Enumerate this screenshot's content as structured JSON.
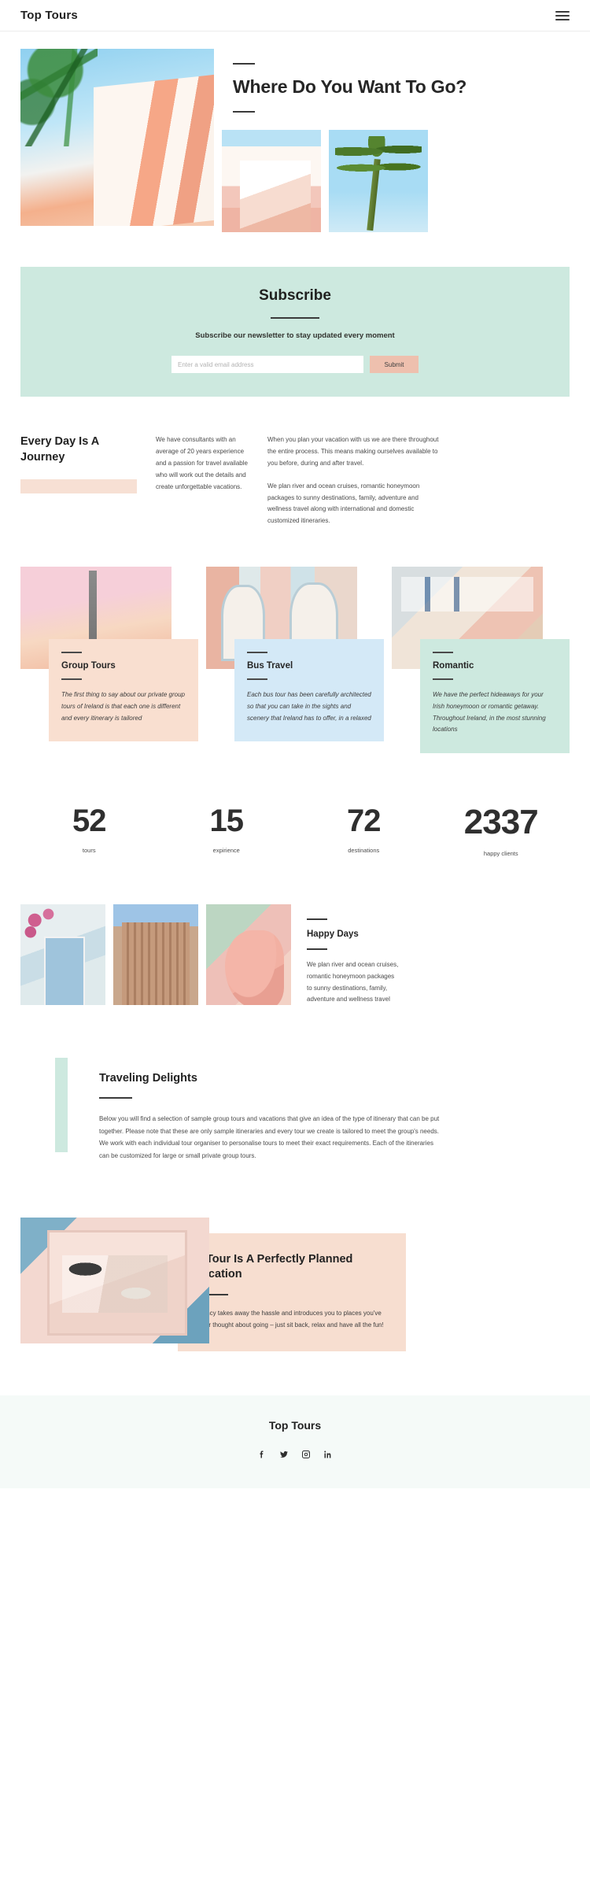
{
  "header": {
    "logo": "Top Tours",
    "menu_icon": "hamburger-menu-icon"
  },
  "hero": {
    "title": "Where Do You Want To Go?",
    "images": [
      "palm-and-pastel-building-photo",
      "pastel-architecture-photo",
      "palm-tree-photo"
    ]
  },
  "subscribe": {
    "title": "Subscribe",
    "subtitle": "Subscribe our newsletter to stay updated every moment",
    "input_placeholder": "Enter a valid email address",
    "input_value": "",
    "button_label": "Submit",
    "bg_color": "#cde9df",
    "button_color": "#eec0ae"
  },
  "everyday": {
    "title": "Every Day Is A Journey",
    "accent_color": "#f7e0d4",
    "column_1": "We have consultants with an average of 20 years experience and a passion for travel available who will work out the details and create unforgettable vacations.",
    "column_2_p1": "When you plan your vacation with us we are there throughout the entire process. This means making ourselves available to you before, during and after travel.",
    "column_2_p2": "We plan river and ocean cruises, romantic honeymoon packages to sunny destinations, family, adventure and wellness travel along with international and domestic customized itineraries."
  },
  "cards": [
    {
      "title": "Group Tours",
      "text": "The first thing to say about our private group tours of Ireland is that each one is different and every itinerary is tailored",
      "bg_color": "#f9dfd0",
      "image": "tower-sunset-photo"
    },
    {
      "title": "Bus Travel",
      "text": "Each bus tour has been carefully architected so that you can take in the sights and scenery that Ireland has to offer, in a relaxed",
      "bg_color": "#d4e9f7",
      "image": "colorful-doors-photo"
    },
    {
      "title": "Romantic",
      "text": "We have the perfect hideaways for your Irish honeymoon or romantic getaway. Throughout Ireland, in the most stunning locations",
      "bg_color": "#cde9df",
      "image": "nice-building-photo"
    }
  ],
  "stats": [
    {
      "number": "52",
      "label": "tours"
    },
    {
      "number": "15",
      "label": "expirience"
    },
    {
      "number": "72",
      "label": "destinations"
    },
    {
      "number": "2337",
      "label": "happy clients"
    }
  ],
  "happy_days": {
    "title": "Happy Days",
    "text": "We plan river and ocean cruises, romantic honeymoon packages to sunny destinations, family, adventure and wellness travel",
    "images": [
      "greek-doorway-photo",
      "flatiron-building-photo",
      "flamingo-photo"
    ]
  },
  "delights": {
    "title": "Traveling Delights",
    "text": "Below you will find a selection of sample group tours and vacations that give an idea of the type of itinerary that can be put together. Please note that these are only sample itineraries and every tour we create is tailored to meet the group's needs. We work with each individual tour organiser to personalise tours to meet their exact requirements. Each of the itineraries can be customized for large or small private group tours.",
    "accent_color": "#cde9df"
  },
  "banner": {
    "title": "A Tour Is A Perfectly Planned Vacation",
    "text": "Agency takes away the hassle and introduces you to places you've never thought about going – just sit back, relax and have all the fun!",
    "bg_color": "#f7ded0",
    "image": "packed-suitcase-photo"
  },
  "footer": {
    "logo": "Top Tours",
    "bg_color": "#f5faf8",
    "socials": [
      {
        "name": "facebook-icon"
      },
      {
        "name": "twitter-icon"
      },
      {
        "name": "instagram-icon"
      },
      {
        "name": "linkedin-icon"
      }
    ]
  }
}
